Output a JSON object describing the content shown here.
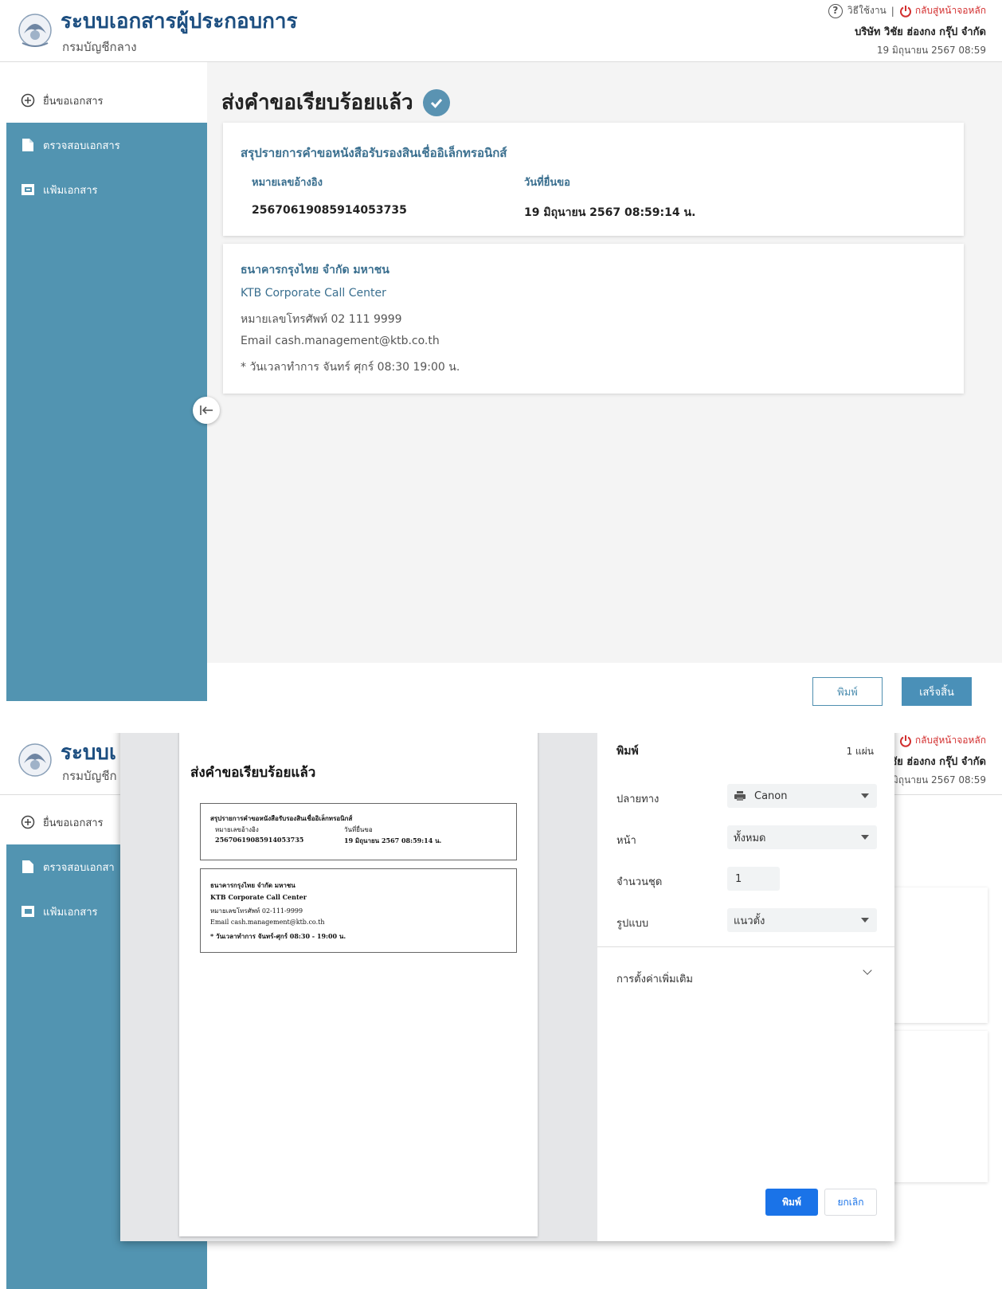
{
  "header": {
    "title": "ระบบเอกสารผู้ประกอบการ",
    "title_partial": "ระบบเ",
    "subtitle": "กรมบัญชีกลาง",
    "subtitle_partial": "กรมบัญชีก",
    "help_label": "วิธีใช้งาน",
    "separator": "|",
    "home_label": "กลับสู่หน้าจอหลัก",
    "company": "บริษัท วิชัย ฮ่องกง กรุ๊ป จำกัด",
    "company_partial": "วิชัย ฮ่องกง กรุ๊ป จำกัด",
    "datetime": "19 มิถุนายน 2567 08:59",
    "datetime_partial": "9 มิถุนายน 2567 08:59"
  },
  "sidebar": {
    "items": [
      {
        "label": "ยื่นขอเอกสาร",
        "icon": "plus-circle-icon"
      },
      {
        "label": "ตรวจสอบเอกสาร",
        "icon": "document-icon"
      },
      {
        "label": "แฟ้มเอกสาร",
        "icon": "folder-icon"
      }
    ],
    "partial_item_1": "ตรวจสอบเอกสา"
  },
  "main": {
    "page_title": "ส่งคำขอเรียบร้อยแล้ว",
    "summary": {
      "title": "สรุปรายการคำขอหนังสือรับรองสินเชื่ออิเล็กทรอนิกส์",
      "ref_label": "หมายเลขอ้างอิง",
      "ref_value": "25670619085914053735",
      "date_label": "วันที่ยื่นขอ",
      "date_value": "19 มิถุนายน 2567 08:59:14 น."
    },
    "bank": {
      "name": "ธนาคารกรุงไทย จำกัด มหาชน",
      "center": "KTB Corporate Call Center",
      "phone": "หมายเลขโทรศัพท์ 02 111 9999",
      "email": "Email cash.management@ktb.co.th",
      "hours": "* วันเวลาทำการ จันทร์ ศุกร์ 08:30   19:00 น."
    },
    "print_button": "พิมพ์",
    "done_button": "เสร็จสิ้น"
  },
  "print_preview": {
    "title": "ส่งคำขอเรียบร้อยแล้ว",
    "summary_title": "สรุปรายการคำขอหนังสือรับรองสินเชื่ออิเล็กทรอนิกส์",
    "ref_label": "หมายเลขอ้างอิง",
    "ref_value": "25670619085914053735",
    "date_label": "วันที่ยื่นขอ",
    "date_value": "19 มิถุนายน 2567 08:59:14 น.",
    "bank_name": "ธนาคารกรุงไทย จำกัด มหาชน",
    "center": "KTB Corporate Call Center",
    "phone": "หมายเลขโทรศัพท์ 02-111-9999",
    "email": "Email cash.management@ktb.co.th",
    "hours": "* วันเวลาทำการ จันทร์-ศุกร์ 08:30 - 19:00 น."
  },
  "print_dialog": {
    "title": "พิมพ์",
    "pages_count": "1 แผ่น",
    "destination_label": "ปลายทาง",
    "destination_value": "Canon",
    "pages_label": "หน้า",
    "pages_value": "ทั้งหมด",
    "copies_label": "จำนวนชุด",
    "copies_value": "1",
    "layout_label": "รูปแบบ",
    "layout_value": "แนวตั้ง",
    "more_settings": "การตั้งค่าเพิ่มเติม",
    "print_button": "พิมพ์",
    "cancel_button": "ยกเลิก"
  },
  "colors": {
    "sidebar": "#5294b1",
    "accent": "#3a6f8f",
    "primary_button": "#1a73e8",
    "home_link": "#d32f2f"
  }
}
